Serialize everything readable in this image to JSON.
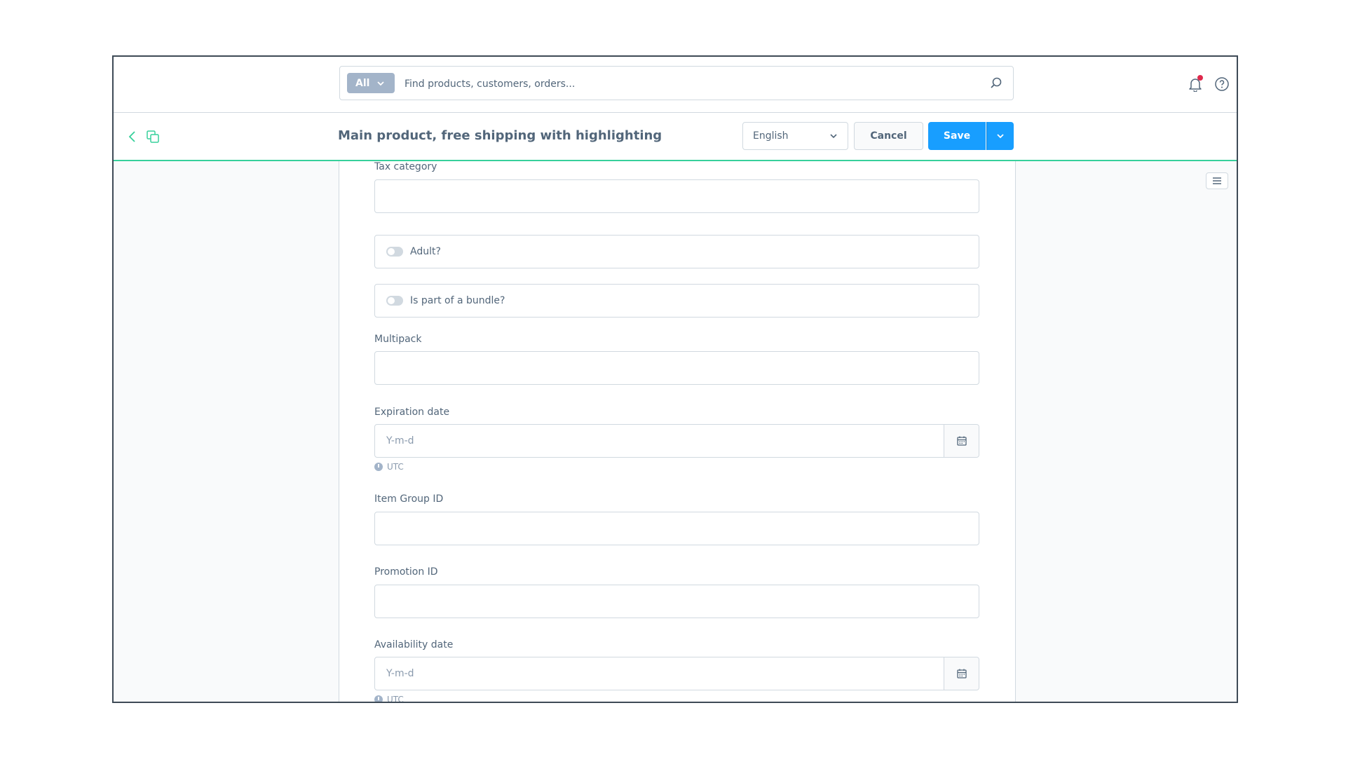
{
  "search": {
    "type_label": "All",
    "placeholder": "Find products, customers, orders..."
  },
  "smartbar": {
    "title": "Main product, free shipping with highlighting",
    "language": "English",
    "cancel_label": "Cancel",
    "save_label": "Save"
  },
  "colors": {
    "primary": "#189eff",
    "accent": "#37d09b",
    "notification": "#de294c",
    "border": "#d1d9e0",
    "text": "#52667a"
  },
  "form": {
    "tax_category": {
      "label": "Tax category",
      "value": ""
    },
    "adult": {
      "label": "Adult?",
      "checked": false
    },
    "bundle": {
      "label": "Is part of a bundle?",
      "checked": false
    },
    "multipack": {
      "label": "Multipack",
      "value": ""
    },
    "expiration_date": {
      "label": "Expiration date",
      "placeholder": "Y-m-d",
      "hint": "UTC"
    },
    "item_group_id": {
      "label": "Item Group ID",
      "value": ""
    },
    "promotion_id": {
      "label": "Promotion ID",
      "value": ""
    },
    "availability_date": {
      "label": "Availability date",
      "placeholder": "Y-m-d",
      "hint": "UTC"
    }
  },
  "icons": {
    "search": "search-icon",
    "notifications": "bell-icon",
    "help": "help-icon",
    "back": "chevron-left-icon",
    "copy": "copy-icon",
    "calendar": "calendar-icon",
    "sidebar": "menu-icon"
  }
}
